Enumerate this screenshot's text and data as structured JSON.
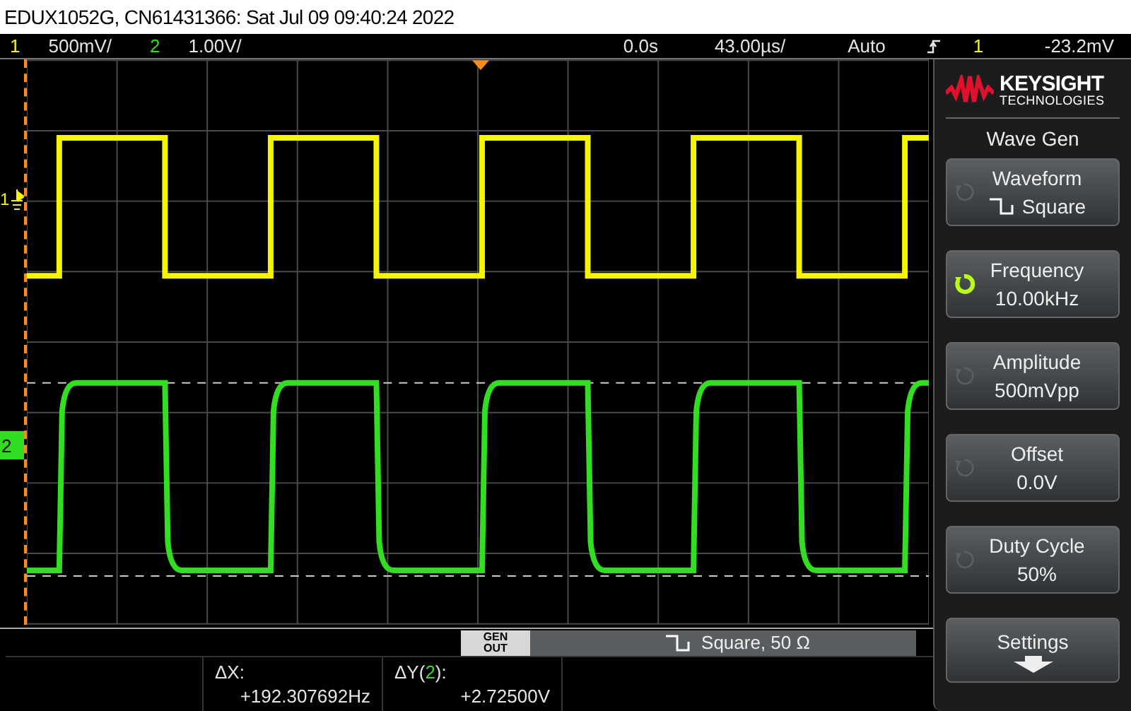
{
  "title_bar": {
    "text": "EDUX1052G, CN61431366: Sat Jul 09 09:40:24 2022"
  },
  "status_bar": {
    "channels": [
      {
        "number": "1",
        "scale": "500mV/",
        "color": "#f5f500"
      },
      {
        "number": "2",
        "scale": "1.00V/",
        "color": "#33dd22"
      }
    ],
    "time_offset": "0.0s",
    "timebase": "43.00µs/",
    "trigger_mode": "Auto",
    "trigger_source": "1",
    "trigger_level": "-23.2mV"
  },
  "channel_markers": [
    {
      "number": "1",
      "kind": "ground",
      "color": "#f5f500"
    },
    {
      "number": "2",
      "kind": "box",
      "color": "#33dd22"
    }
  ],
  "gen_out": {
    "button": "GEN OUT",
    "summary": "Square, 50 Ω"
  },
  "measurements": [
    {
      "prefix": "ΔX:",
      "value": "+192.307692Hz"
    },
    {
      "prefix": "ΔY(",
      "channel": "2",
      "suffix": "):",
      "value": "+2.72500V"
    }
  ],
  "brand": {
    "name": "KEYSIGHT",
    "subtitle": "TECHNOLOGIES"
  },
  "menu_title": "Wave Gen",
  "softkeys": [
    {
      "kind": "knob",
      "label": "Waveform",
      "value": "Square",
      "waveform_icon": true,
      "knob_active": false
    },
    {
      "kind": "knob",
      "label": "Frequency",
      "value": "10.00kHz",
      "waveform_icon": false,
      "knob_active": true
    },
    {
      "kind": "knob",
      "label": "Amplitude",
      "value": "500mVpp",
      "waveform_icon": false,
      "knob_active": false
    },
    {
      "kind": "knob",
      "label": "Offset",
      "value": "0.0V",
      "waveform_icon": false,
      "knob_active": false
    },
    {
      "kind": "knob",
      "label": "Duty Cycle",
      "value": "50%",
      "waveform_icon": false,
      "knob_active": false
    },
    {
      "kind": "submenu",
      "label": "Settings"
    }
  ]
}
